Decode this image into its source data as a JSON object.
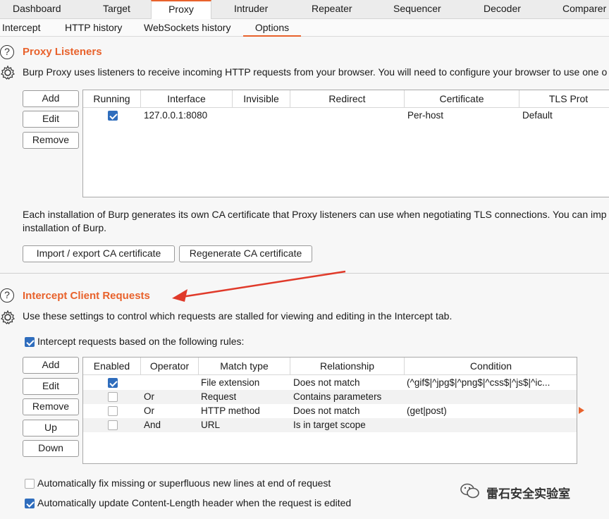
{
  "tabs": [
    {
      "label": "Dashboard"
    },
    {
      "label": "Target"
    },
    {
      "label": "Proxy"
    },
    {
      "label": "Intruder"
    },
    {
      "label": "Repeater"
    },
    {
      "label": "Sequencer"
    },
    {
      "label": "Decoder"
    },
    {
      "label": "Comparer"
    }
  ],
  "subtabs": [
    {
      "label": "Intercept"
    },
    {
      "label": "HTTP history"
    },
    {
      "label": "WebSockets history"
    },
    {
      "label": "Options"
    }
  ],
  "listeners": {
    "title": "Proxy Listeners",
    "description": "Burp Proxy uses listeners to receive incoming HTTP requests from your browser. You will need to configure your browser to use one o",
    "buttons": {
      "add": "Add",
      "edit": "Edit",
      "remove": "Remove"
    },
    "columns": [
      "Running",
      "Interface",
      "Invisible",
      "Redirect",
      "Certificate",
      "TLS Prot"
    ],
    "rows": [
      {
        "running": true,
        "interface": "127.0.0.1:8080",
        "invisible": "",
        "redirect": "",
        "certificate": "Per-host",
        "tls": "Default"
      }
    ],
    "ca_text_1": "Each installation of Burp generates its own CA certificate that Proxy listeners can use when negotiating TLS connections. You can imp",
    "ca_text_2": "installation of Burp.",
    "import_button": "Import / export CA certificate",
    "regenerate_button": "Regenerate CA certificate"
  },
  "intercept": {
    "title": "Intercept Client Requests",
    "description": "Use these settings to control which requests are stalled for viewing and editing in the Intercept tab.",
    "rules_checkbox": {
      "label": "Intercept requests based on the following rules:",
      "checked": true
    },
    "buttons": {
      "add": "Add",
      "edit": "Edit",
      "remove": "Remove",
      "up": "Up",
      "down": "Down"
    },
    "columns": [
      "Enabled",
      "Operator",
      "Match type",
      "Relationship",
      "Condition"
    ],
    "rows": [
      {
        "enabled": true,
        "operator": "",
        "match_type": "File extension",
        "relationship": "Does not match",
        "condition": "(^gif$|^jpg$|^png$|^css$|^js$|^ic..."
      },
      {
        "enabled": false,
        "operator": "Or",
        "match_type": "Request",
        "relationship": "Contains parameters",
        "condition": ""
      },
      {
        "enabled": false,
        "operator": "Or",
        "match_type": "HTTP method",
        "relationship": "Does not match",
        "condition": "(get|post)"
      },
      {
        "enabled": false,
        "operator": "And",
        "match_type": "URL",
        "relationship": "Is in target scope",
        "condition": ""
      }
    ],
    "fix_newlines": {
      "label": "Automatically fix missing or superfluous new lines at end of request",
      "checked": false
    },
    "update_length": {
      "label": "Automatically update Content-Length header when the request is edited",
      "checked": true
    }
  },
  "watermark": {
    "text": "雷石安全实验室"
  },
  "colors": {
    "accent": "#e8622c",
    "checkbox": "#2f6dbd",
    "arrow": "#e03a2a"
  }
}
